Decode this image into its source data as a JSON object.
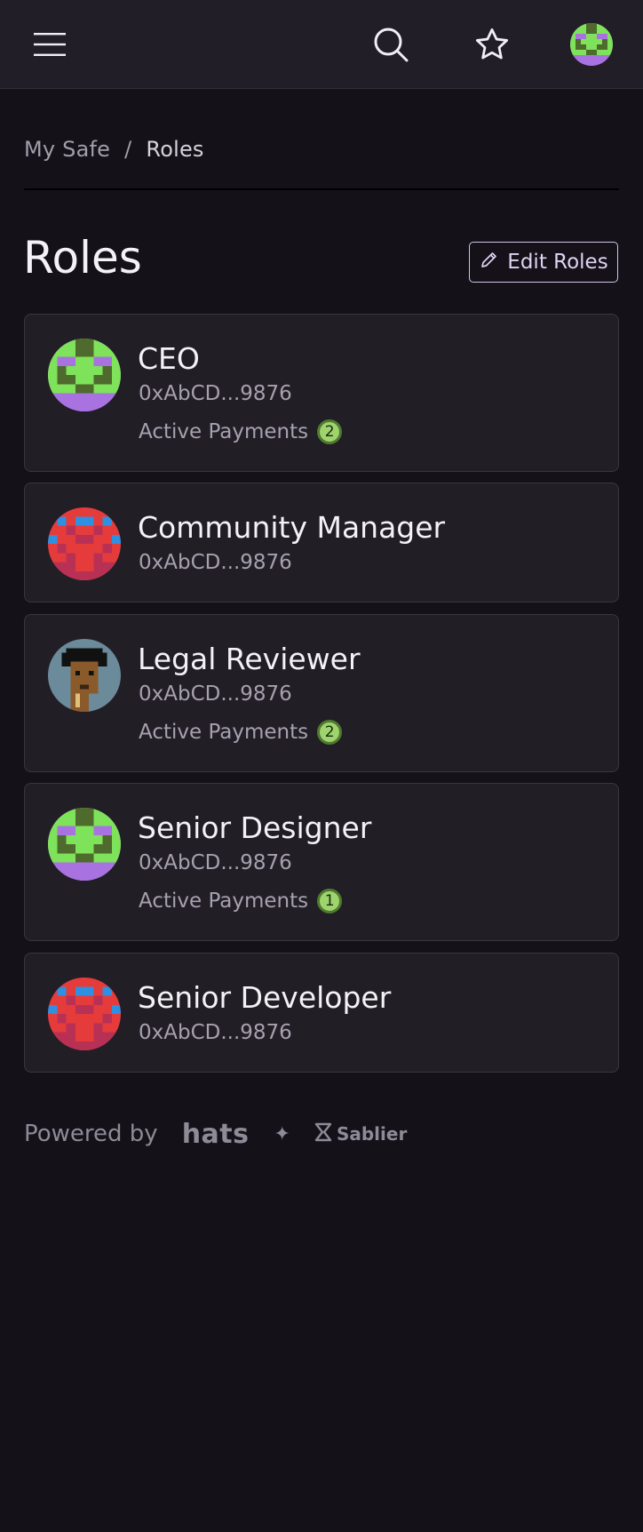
{
  "topbar": {
    "menu_icon": "hamburger-menu-icon",
    "search_icon": "search-icon",
    "star_icon": "star-icon",
    "avatar": "user-avatar"
  },
  "breadcrumb": {
    "parent": "My Safe",
    "separator": "/",
    "current": "Roles"
  },
  "page": {
    "title": "Roles",
    "edit_button_label": "Edit Roles",
    "edit_icon": "pencil-icon"
  },
  "roles": [
    {
      "name": "CEO",
      "address": "0xAbCD...9876",
      "payments_label": "Active Payments",
      "payments_count": "2",
      "avatar_style": "green-purple"
    },
    {
      "name": "Community Manager",
      "address": "0xAbCD...9876",
      "avatar_style": "red-blue"
    },
    {
      "name": "Legal Reviewer",
      "address": "0xAbCD...9876",
      "payments_label": "Active Payments",
      "payments_count": "2",
      "avatar_style": "punk"
    },
    {
      "name": "Senior Designer",
      "address": "0xAbCD...9876",
      "payments_label": "Active Payments",
      "payments_count": "1",
      "avatar_style": "green-purple"
    },
    {
      "name": "Senior Developer",
      "address": "0xAbCD...9876",
      "avatar_style": "red-blue"
    }
  ],
  "footer": {
    "powered_by": "Powered by",
    "hats_logo": "hats",
    "sparkle": "✦",
    "sablier_logo": "Sablier"
  },
  "colors": {
    "background": "#141119",
    "topbar": "#221e28",
    "card": "#221e26",
    "badge_fill": "#9fd36d",
    "edit_border": "#cfc4e8"
  }
}
